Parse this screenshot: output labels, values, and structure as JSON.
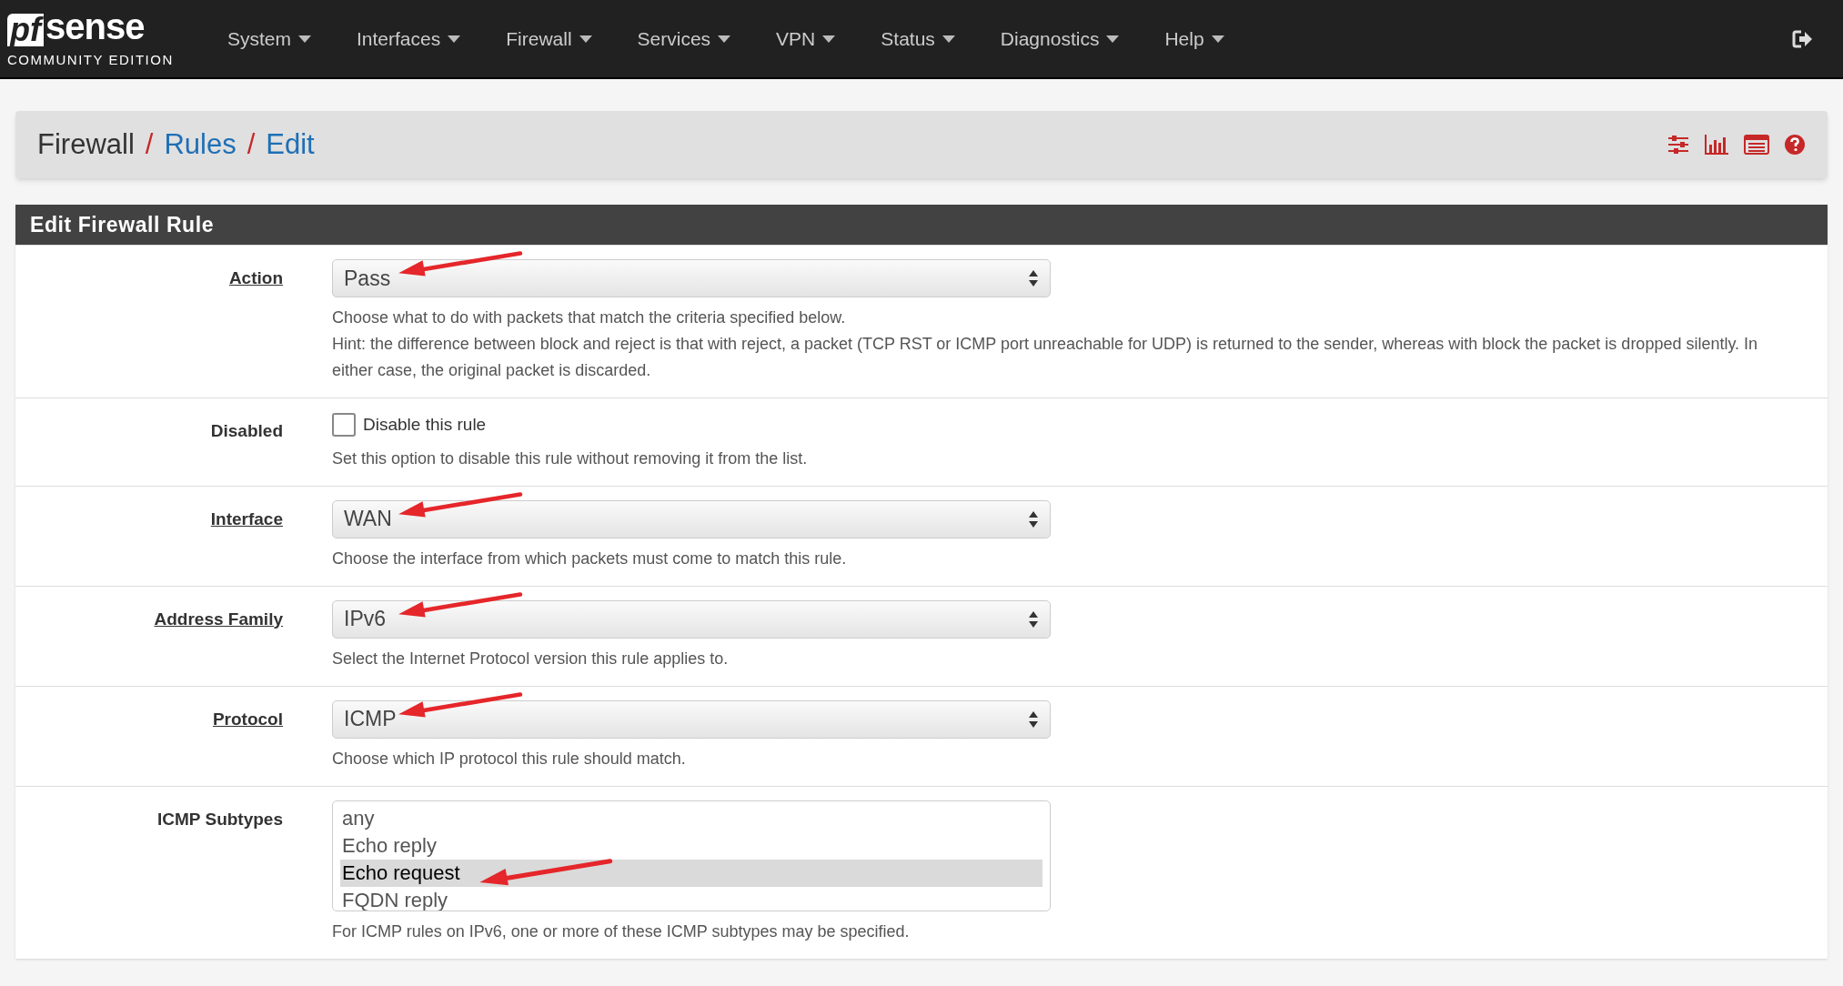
{
  "brand": {
    "logo": "sense",
    "logo_prefix": "pf",
    "edition": "COMMUNITY EDITION"
  },
  "nav": [
    "System",
    "Interfaces",
    "Firewall",
    "Services",
    "VPN",
    "Status",
    "Diagnostics",
    "Help"
  ],
  "breadcrumb_separator": "/",
  "breadcrumb": [
    {
      "label": "Firewall",
      "link": false
    },
    {
      "label": "Rules",
      "link": true
    },
    {
      "label": "Edit",
      "link": true
    }
  ],
  "panel": {
    "title": "Edit Firewall Rule",
    "fields": [
      {
        "kind": "select",
        "label": "Action",
        "value": "Pass",
        "marked": true,
        "help": [
          "Choose what to do with packets that match the criteria specified below.",
          "Hint: the difference between block and reject is that with reject, a packet (TCP RST or ICMP port unreachable for UDP) is returned to the sender, whereas with block the packet is dropped silently. In either case, the original packet is discarded."
        ]
      },
      {
        "kind": "checkbox",
        "label": "Disabled",
        "text": "Disable this rule",
        "checked": false,
        "help": [
          "Set this option to disable this rule without removing it from the list."
        ]
      },
      {
        "kind": "select",
        "label": "Interface",
        "value": "WAN",
        "marked": true,
        "help": [
          "Choose the interface from which packets must come to match this rule."
        ]
      },
      {
        "kind": "select",
        "label": "Address Family",
        "value": "IPv6",
        "marked": true,
        "help": [
          "Select the Internet Protocol version this rule applies to."
        ]
      },
      {
        "kind": "select",
        "label": "Protocol",
        "value": "ICMP",
        "marked": true,
        "help": [
          "Choose which IP protocol this rule should match."
        ]
      },
      {
        "kind": "listbox",
        "label": "ICMP Subtypes",
        "options": [
          {
            "label": "any",
            "selected": false,
            "marked": false
          },
          {
            "label": "Echo reply",
            "selected": false,
            "marked": false
          },
          {
            "label": "Echo request",
            "selected": true,
            "marked": true
          },
          {
            "label": "FQDN reply",
            "selected": false,
            "marked": false
          }
        ],
        "help": [
          "For ICMP rules on IPv6, one or more of these ICMP subtypes may be specified."
        ]
      }
    ]
  }
}
